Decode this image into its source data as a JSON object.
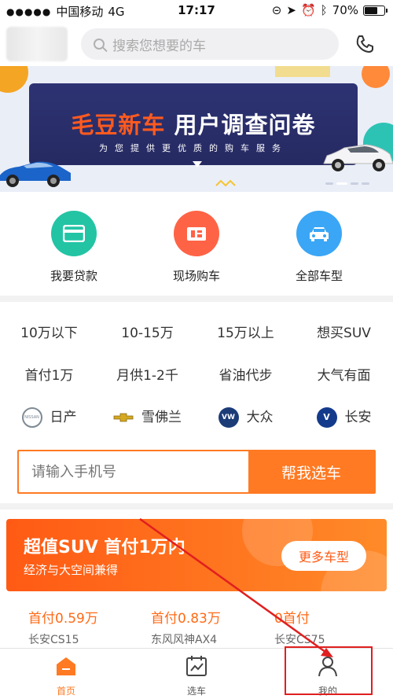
{
  "status_bar": {
    "dots": "●●●●●",
    "carrier": "中国移动",
    "network": "4G",
    "time": "17:17",
    "battery": "70%",
    "battery_level": 0.7
  },
  "header": {
    "search_placeholder": "搜索您想要的车"
  },
  "banner": {
    "title_part1": "毛豆新车",
    "title_part2": "用户调查问卷",
    "subtitle": "为您提供更优质的购车服务"
  },
  "features": [
    {
      "label": "我要贷款",
      "color": "#22c4a4",
      "icon": "card-icon"
    },
    {
      "label": "现场购车",
      "color": "#ff6346",
      "icon": "store-icon"
    },
    {
      "label": "全部车型",
      "color": "#3aa6f5",
      "icon": "car-icon"
    }
  ],
  "filters": {
    "row1": [
      "10万以下",
      "10-15万",
      "15万以上",
      "想买SUV"
    ],
    "row2": [
      "首付1万",
      "月供1-2千",
      "省油代步",
      "大气有面"
    ],
    "brands": [
      {
        "name": "日产",
        "icon": "nissan-logo-icon",
        "logo_text": "NISSAN",
        "color": "#7f8a94"
      },
      {
        "name": "雪佛兰",
        "icon": "chevrolet-logo-icon",
        "logo_text": "",
        "color": "#d4a821"
      },
      {
        "name": "大众",
        "icon": "volkswagen-logo-icon",
        "logo_text": "VW",
        "color": "#1c3c78"
      },
      {
        "name": "长安",
        "icon": "changan-logo-icon",
        "logo_text": "V",
        "color": "#143a8c"
      }
    ]
  },
  "phone_form": {
    "placeholder": "请输入手机号",
    "button": "帮我选车"
  },
  "promo": {
    "title": "超值SUV 首付1万内",
    "subtitle": "经济与大空间兼得",
    "more_button": "更多车型"
  },
  "cars": [
    {
      "price": "首付0.59万",
      "name": "长安CS15"
    },
    {
      "price": "首付0.83万",
      "name": "东风风神AX4"
    },
    {
      "price": "0首付",
      "name": "长安CS75"
    }
  ],
  "tabbar": [
    {
      "label": "首页",
      "icon": "home-icon",
      "active": true
    },
    {
      "label": "选车",
      "icon": "calendar-chart-icon",
      "active": false
    },
    {
      "label": "我的",
      "icon": "user-icon",
      "active": false
    }
  ],
  "colors": {
    "accent": "#ff7a22",
    "annotation_red": "#e01f1f"
  }
}
